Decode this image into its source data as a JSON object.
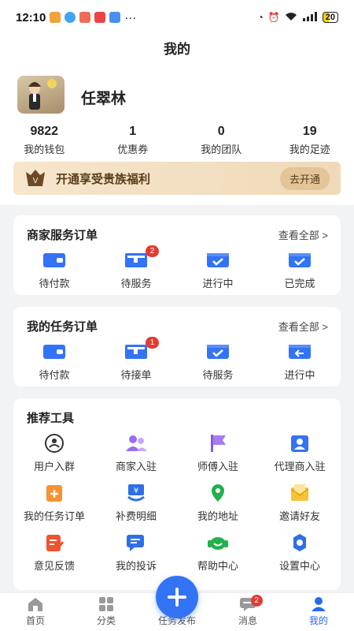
{
  "status_bar": {
    "time": "12:10",
    "more": "···",
    "battery": "20"
  },
  "header": {
    "title": "我的"
  },
  "profile": {
    "name": "任翠林"
  },
  "stats": [
    {
      "value": "9822",
      "label": "我的钱包"
    },
    {
      "value": "1",
      "label": "优惠券"
    },
    {
      "value": "0",
      "label": "我的团队"
    },
    {
      "value": "19",
      "label": "我的足迹"
    }
  ],
  "vip": {
    "text": "开通享受贵族福利",
    "button": "去开通"
  },
  "merchant_orders": {
    "title": "商家服务订单",
    "view_all": "查看全部 >",
    "items": [
      {
        "label": "待付款",
        "icon": "wallet-icon",
        "badge": ""
      },
      {
        "label": "待服务",
        "icon": "service-box-icon",
        "badge": "2"
      },
      {
        "label": "进行中",
        "icon": "inbox-progress-icon",
        "badge": ""
      },
      {
        "label": "已完成",
        "icon": "inbox-check-icon",
        "badge": ""
      }
    ]
  },
  "task_orders": {
    "title": "我的任务订单",
    "view_all": "查看全部 >",
    "items": [
      {
        "label": "待付款",
        "icon": "wallet-icon",
        "badge": ""
      },
      {
        "label": "待接单",
        "icon": "accept-box-icon",
        "badge": "1"
      },
      {
        "label": "待服务",
        "icon": "inbox-check-icon",
        "badge": ""
      },
      {
        "label": "进行中",
        "icon": "inbox-progress-icon",
        "badge": ""
      }
    ]
  },
  "tools": {
    "title": "推荐工具",
    "items": [
      {
        "label": "用户入群",
        "icon": "group-chat-icon"
      },
      {
        "label": "商家入驻",
        "icon": "merchant-users-icon"
      },
      {
        "label": "师傅入驻",
        "icon": "flag-icon"
      },
      {
        "label": "代理商入驻",
        "icon": "id-card-icon"
      },
      {
        "label": "我的任务订单",
        "icon": "task-order-icon"
      },
      {
        "label": "补费明细",
        "icon": "fee-detail-icon"
      },
      {
        "label": "我的地址",
        "icon": "location-pin-icon"
      },
      {
        "label": "邀请好友",
        "icon": "invite-envelope-icon"
      },
      {
        "label": "意见反馈",
        "icon": "feedback-edit-icon"
      },
      {
        "label": "我的投诉",
        "icon": "complaint-chat-icon"
      },
      {
        "label": "帮助中心",
        "icon": "headset-icon"
      },
      {
        "label": "设置中心",
        "icon": "gear-icon"
      }
    ]
  },
  "tabbar": {
    "items": [
      {
        "label": "首页"
      },
      {
        "label": "分类"
      },
      {
        "label": "任务发布"
      },
      {
        "label": "消息",
        "badge": "2"
      },
      {
        "label": "我的"
      }
    ]
  },
  "colors": {
    "accent": "#3373f5",
    "badge": "#e23b33",
    "vip_text": "#5a3c1c"
  }
}
